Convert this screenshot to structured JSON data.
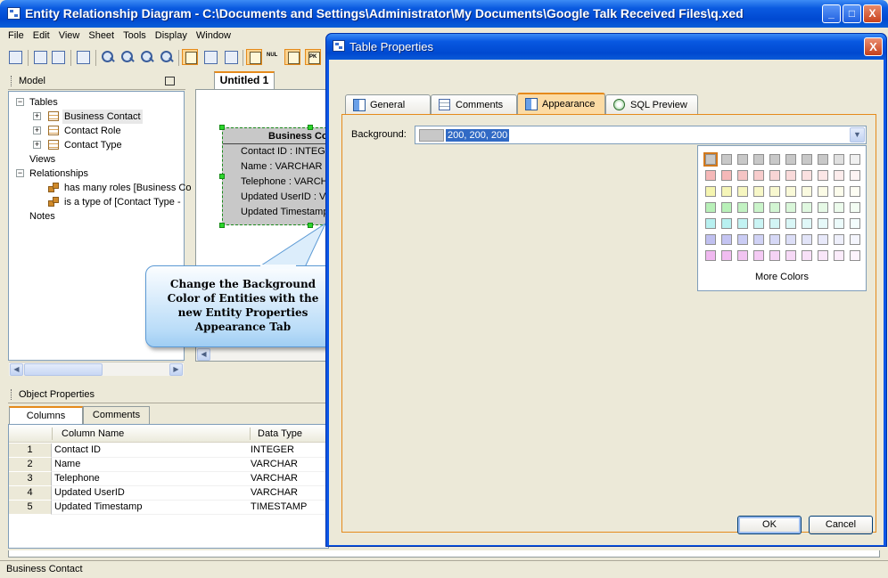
{
  "window": {
    "title": "Entity Relationship Diagram - C:\\Documents and Settings\\Administrator\\My Documents\\Google Talk Received Files\\q.xed",
    "minimize": "_",
    "maximize": "□",
    "close": "X"
  },
  "menu": [
    "File",
    "Edit",
    "View",
    "Sheet",
    "Tools",
    "Display",
    "Window"
  ],
  "toolbar": {
    "nul_label": "NUL",
    "key_label": "PK"
  },
  "model": {
    "header": "Model",
    "tables_label": "Tables",
    "tables": [
      "Business Contact",
      "Contact Role",
      "Contact Type"
    ],
    "views_label": "Views",
    "relationships_label": "Relationships",
    "relationships": [
      "has many roles [Business Co",
      "is a type of [Contact Type -"
    ],
    "notes_label": "Notes"
  },
  "diagram": {
    "tab": "Untitled 1",
    "entity": {
      "name": "Business Co",
      "fields": [
        "Contact ID : INTEGE",
        "Name : VARCHAR (2",
        "Telephone : VARCH",
        "Updated UserID : V",
        "Updated Timestamp"
      ]
    }
  },
  "callout": {
    "lines": [
      "Change the Background",
      "Color of Entities with the",
      "new Entity Properties",
      "Appearance Tab"
    ]
  },
  "object_properties": {
    "header": "Object Properties",
    "tabs": [
      "Columns",
      "Comments"
    ],
    "columns": [
      "Column Name",
      "Data Type"
    ],
    "rows": [
      {
        "num": "1",
        "name": "Contact ID",
        "type": "INTEGER"
      },
      {
        "num": "2",
        "name": "Name",
        "type": "VARCHAR"
      },
      {
        "num": "3",
        "name": "Telephone",
        "type": "VARCHAR"
      },
      {
        "num": "4",
        "name": "Updated UserID",
        "type": "VARCHAR"
      },
      {
        "num": "5",
        "name": "Updated Timestamp",
        "type": "TIMESTAMP"
      }
    ]
  },
  "status": "Business Contact",
  "dialog": {
    "title": "Table Properties",
    "close": "X",
    "tabs": [
      "General",
      "Comments",
      "Appearance",
      "SQL Preview"
    ],
    "active_tab": "Appearance",
    "background_label": "Background:",
    "background_value": "200, 200, 200",
    "palette": {
      "colors": [
        [
          "#c8c8c8",
          "#c8c8c8",
          "#c8c8c8",
          "#c8c8c8",
          "#c8c8c8",
          "#c8c8c8",
          "#c8c8c8",
          "#c8c8c8",
          "#e0e0e0",
          "#f0f0f0"
        ],
        [
          "#f5b8b8",
          "#f5b8b8",
          "#f5c4c4",
          "#f7cccc",
          "#f8d4d4",
          "#f9dada",
          "#fae0e0",
          "#fbe6e6",
          "#fcecec",
          "#fdf3f3"
        ],
        [
          "#f5f5b0",
          "#f5f5b8",
          "#f6f6c0",
          "#f7f7c8",
          "#f8f8d0",
          "#f9f9d8",
          "#fafae0",
          "#fbfbe6",
          "#fcfcec",
          "#fdfdf3"
        ],
        [
          "#b8f0b8",
          "#b8f0b8",
          "#c2f2c2",
          "#caf4ca",
          "#d2f5d2",
          "#d9f6d9",
          "#e0f8e0",
          "#e6f9e6",
          "#ecfbec",
          "#f3fdf3"
        ],
        [
          "#b8f0f0",
          "#b8f0f0",
          "#c2f2f2",
          "#caf4f4",
          "#d2f5f5",
          "#d9f6f6",
          "#e0f8f8",
          "#e6f9f9",
          "#ecfbfb",
          "#f3fdfd"
        ],
        [
          "#c0c0f0",
          "#c4c4f2",
          "#caccf4",
          "#d0d2f5",
          "#d6d8f6",
          "#dcdef7",
          "#e2e4f8",
          "#e8e9fa",
          "#eeeffb",
          "#f4f5fd"
        ],
        [
          "#f0b8f0",
          "#f0bcf0",
          "#f2c4f2",
          "#f4caf4",
          "#f5d2f5",
          "#f6d9f6",
          "#f8e0f8",
          "#f9e6f9",
          "#fbecfb",
          "#fdf3fd"
        ]
      ],
      "more_colors": "More Colors"
    },
    "ok": "OK",
    "cancel": "Cancel"
  },
  "colors": {
    "xp_blue": "#0049d1",
    "accent_orange": "#e58a1b",
    "entity_fill": "#c8c8c8",
    "selection": "#316ac5"
  }
}
